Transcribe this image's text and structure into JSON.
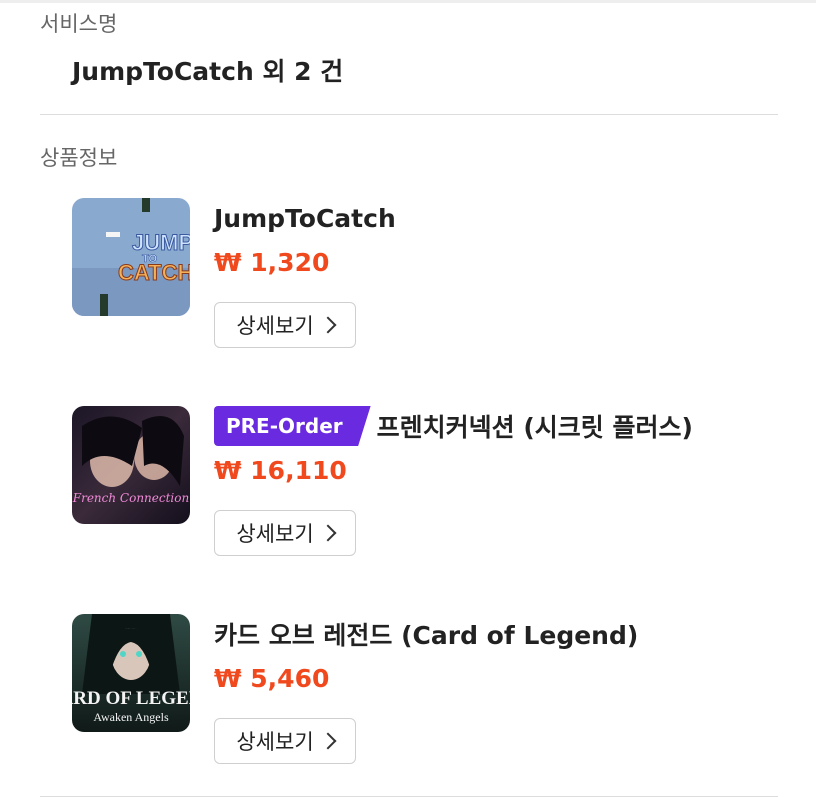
{
  "service": {
    "label": "서비스명",
    "name": "JumpToCatch 외 2 건"
  },
  "products_section": {
    "label": "상품정보",
    "items": [
      {
        "title": "JumpToCatch",
        "price": "₩ 1,320",
        "detail_label": "상세보기",
        "badge": "",
        "thumb_text": [
          "JUMP",
          "TO",
          "CATCH"
        ]
      },
      {
        "title": "프렌치커넥션 (시크릿 플러스)",
        "price": "₩ 16,110",
        "detail_label": "상세보기",
        "badge": "PRE-Order",
        "thumb_text": [
          "French Connection"
        ]
      },
      {
        "title": "카드 오브 레전드 (Card of Legend)",
        "price": "₩ 5,460",
        "detail_label": "상세보기",
        "badge": "",
        "thumb_text": [
          "ARD OF LEGEN",
          "Awaken Angels"
        ]
      }
    ]
  },
  "colors": {
    "price": "#f0491e",
    "badge": "#6a2ae0",
    "divider": "#dddddd"
  },
  "icons": [
    "chevron-right-icon"
  ]
}
